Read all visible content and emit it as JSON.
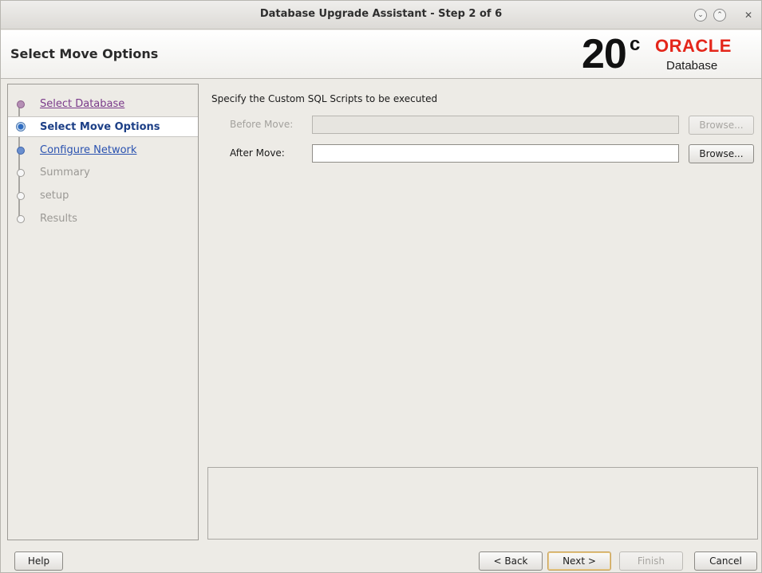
{
  "window": {
    "title": "Database Upgrade Assistant - Step 2 of 6",
    "controls": {
      "minimize": "⌄",
      "maximize": "⌃",
      "close": "✕"
    }
  },
  "header": {
    "page_title": "Select Move Options",
    "brand": {
      "version": "20",
      "version_sup": "c",
      "vendor": "ORACLE",
      "product": "Database",
      "vendor_color": "#e4261a"
    }
  },
  "sidebar": {
    "steps": [
      {
        "label": "Select Database",
        "state": "visited"
      },
      {
        "label": "Select Move Options",
        "state": "current"
      },
      {
        "label": "Configure Network",
        "state": "link"
      },
      {
        "label": "Summary",
        "state": "disabled"
      },
      {
        "label": "setup",
        "state": "disabled"
      },
      {
        "label": "Results",
        "state": "disabled"
      }
    ]
  },
  "main": {
    "heading": "Specify the Custom SQL Scripts to be executed",
    "before_move": {
      "label": "Before Move:",
      "value": "",
      "browse_label": "Browse...",
      "enabled": false
    },
    "after_move": {
      "label": "After Move:",
      "value": "",
      "browse_label": "Browse...",
      "enabled": true
    },
    "message": ""
  },
  "footer": {
    "help_label": "Help",
    "back_label": "< Back",
    "next_label": "Next >",
    "finish_label": "Finish",
    "cancel_label": "Cancel"
  }
}
